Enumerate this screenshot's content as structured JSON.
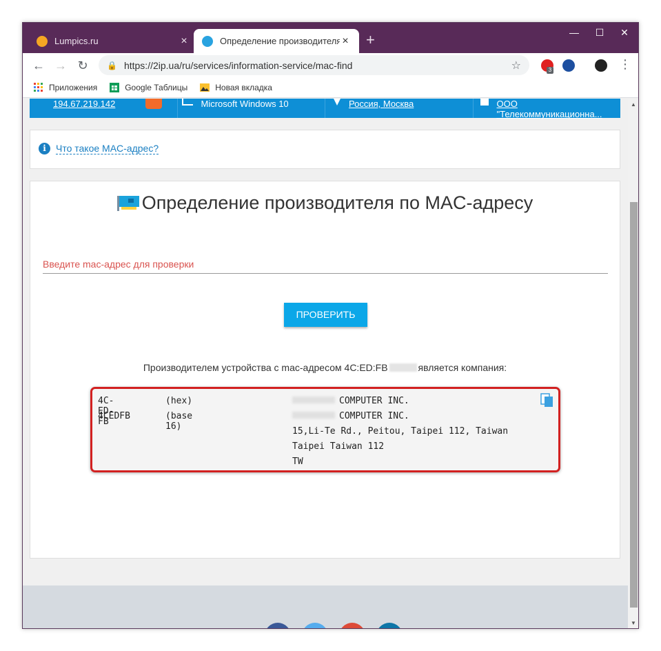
{
  "tabs": [
    {
      "title": "Lumpics.ru",
      "active": false
    },
    {
      "title": "Определение производителя п",
      "active": true
    }
  ],
  "toolbar": {
    "url": "https://2ip.ua/ru/services/information-service/mac-find",
    "ext_badge": "3"
  },
  "bookmarks": [
    {
      "label": "Приложения",
      "icon": "apps-grid-icon"
    },
    {
      "label": "Google Таблицы",
      "icon": "sheets-icon"
    },
    {
      "label": "Новая вкладка",
      "icon": "image-icon"
    }
  ],
  "infobar": {
    "ip": "194.67.219.142",
    "os": "Microsoft Windows 10",
    "location": "Россия, Москва",
    "provider": "ООО \"Телекоммуникационна..."
  },
  "faq_link": "Что такое MAC-адрес?",
  "page_title": "Определение производителя по MAC-адресу",
  "input_placeholder": "Введите mac-адрес для проверки",
  "check_button": "ПРОВЕРИТЬ",
  "result": {
    "prefix": "Производителем устройства с mac-адресом 4C:ED:FB",
    "suffix": "является компания:",
    "rows": [
      {
        "c1": "4C-ED-FB",
        "c2": "(hex)",
        "c3": "COMPUTER INC."
      },
      {
        "c1": "4CEDFB",
        "c2": "(base 16)",
        "c3": "COMPUTER INC."
      },
      {
        "c1": "",
        "c2": "",
        "c3": "15,Li-Te Rd., Peitou, Taipei 112, Taiwan"
      },
      {
        "c1": "",
        "c2": "",
        "c3": "Taipei  Taiwan  112"
      },
      {
        "c1": "",
        "c2": "",
        "c3": "TW"
      }
    ]
  },
  "colors": {
    "titlebar": "#582a58",
    "infobar": "#0e8fd6",
    "button": "#0ba7e8",
    "highlight": "#d22020",
    "placeholder": "#d9534f"
  }
}
